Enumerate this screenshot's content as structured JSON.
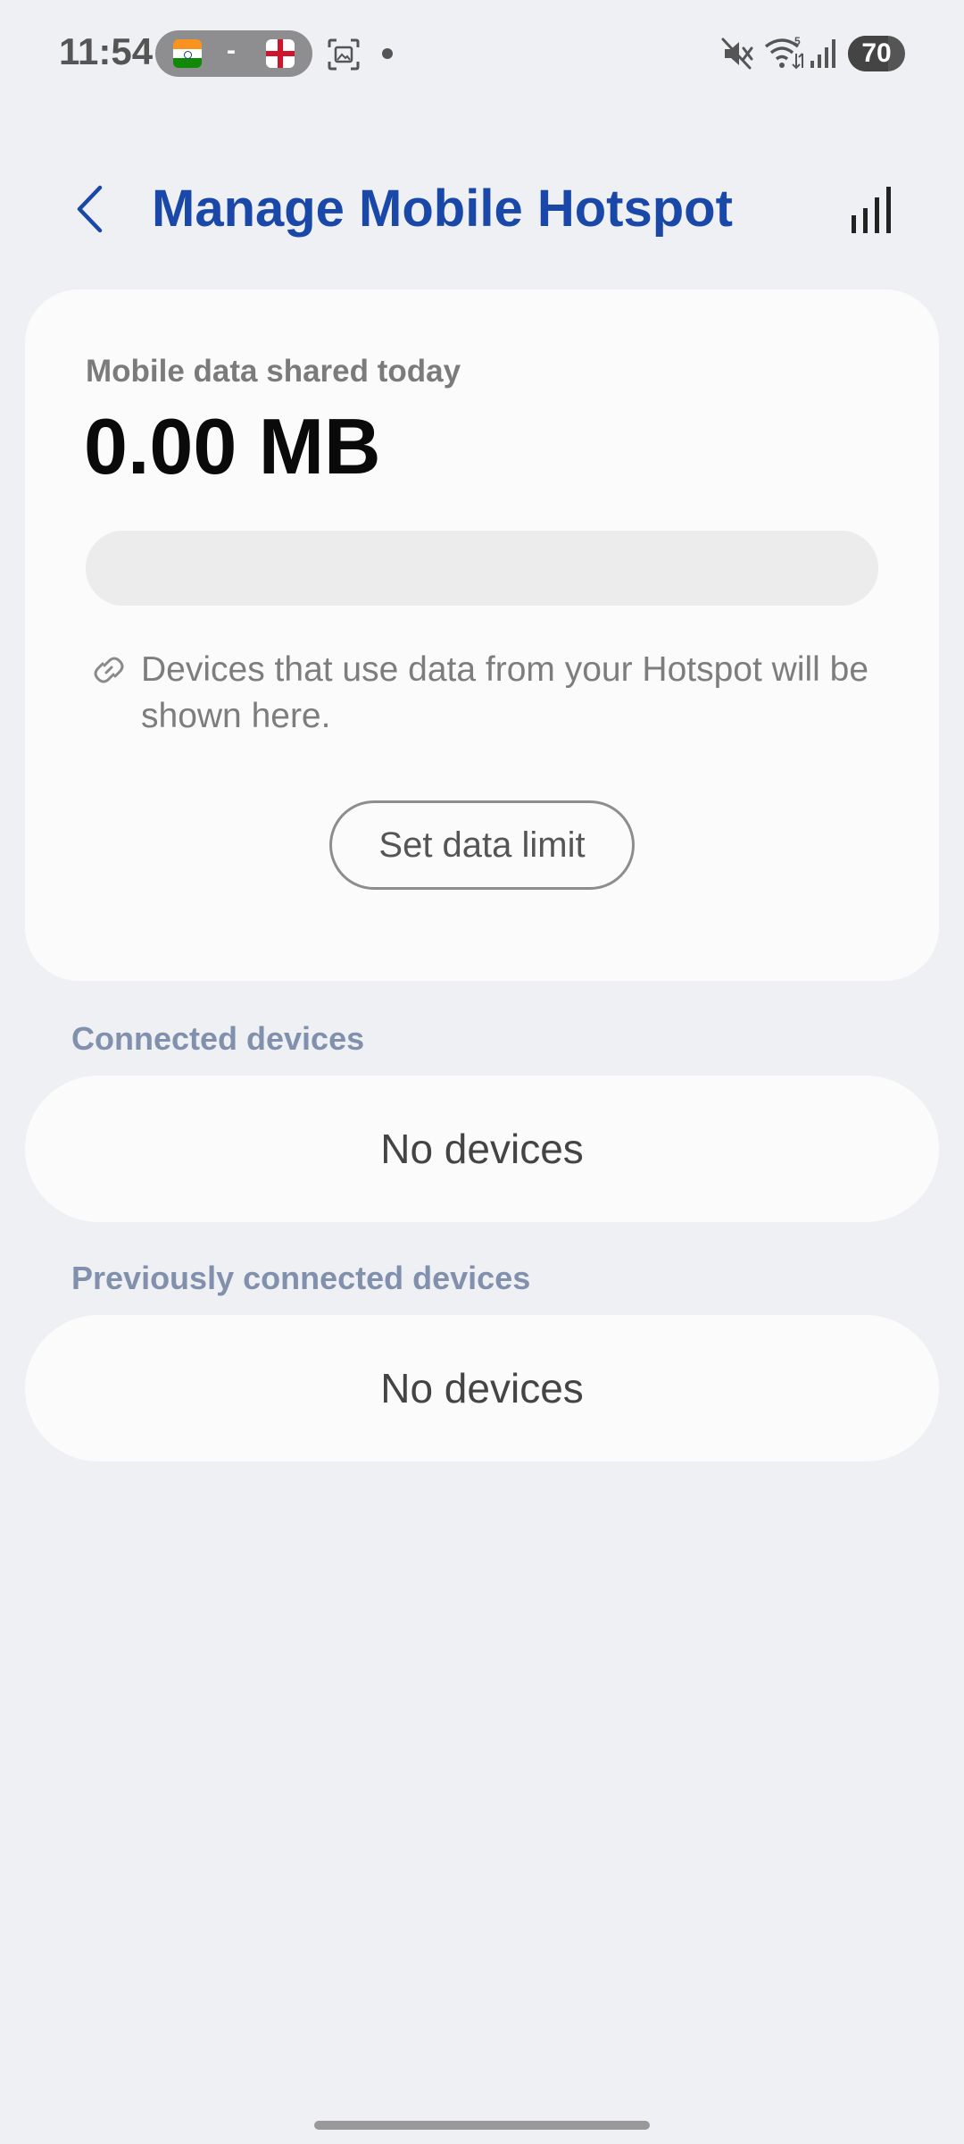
{
  "status_bar": {
    "time": "11:54",
    "score_separator": "-",
    "battery_level": "70",
    "battery_fraction": 0.7,
    "icons": [
      "flag-india-icon",
      "flag-england-icon",
      "screenshot-icon",
      "notification-dot-icon",
      "mute-icon",
      "wifi-icon",
      "signal-icon",
      "battery-icon"
    ]
  },
  "header": {
    "title": "Manage Mobile Hotspot",
    "accent_color": "#1a48a8"
  },
  "usage": {
    "label": "Mobile data shared today",
    "value": "0.00 MB",
    "progress_fraction": 0,
    "info": "Devices that use data from your Hotspot will be shown here.",
    "limit_button": "Set data limit"
  },
  "connected": {
    "title": "Connected devices",
    "empty": "No devices"
  },
  "previous": {
    "title": "Previously connected devices",
    "empty": "No devices"
  },
  "colors": {
    "background": "#eff0f4",
    "card": "#fbfbfb",
    "section_title": "#8090ad"
  }
}
